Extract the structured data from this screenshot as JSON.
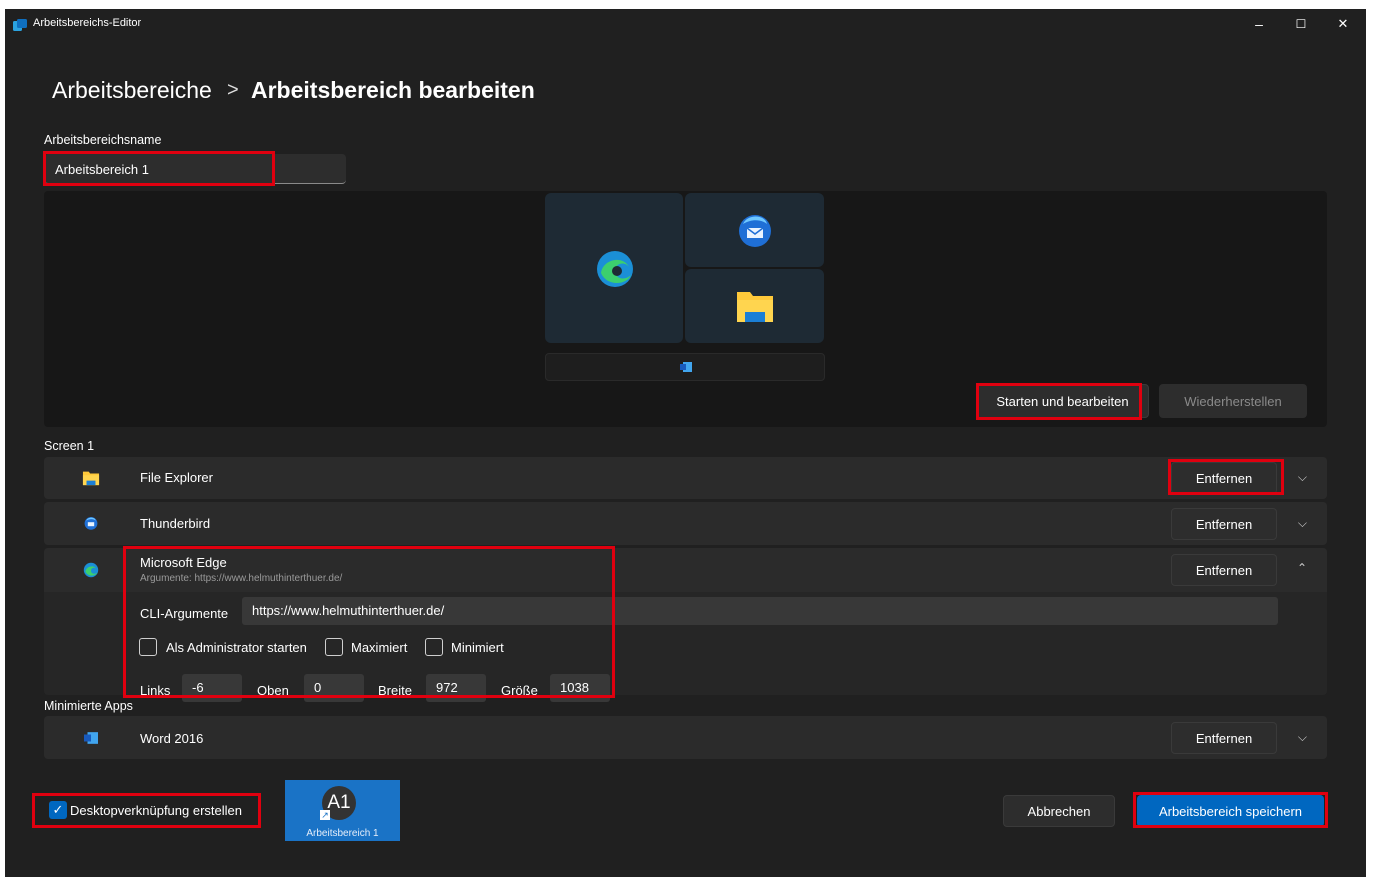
{
  "window": {
    "title": "Arbeitsbereichs-Editor",
    "minimize": "–",
    "maximize": "☐",
    "close": "✕"
  },
  "breadcrumb": {
    "parent": "Arbeitsbereiche",
    "separator": ">",
    "current": "Arbeitsbereich bearbeiten"
  },
  "name_field": {
    "label": "Arbeitsbereichsname",
    "value": "Arbeitsbereich 1"
  },
  "preview": {
    "launch_edit": "Starten und bearbeiten",
    "restore": "Wiederherstellen"
  },
  "screen1": {
    "label": "Screen 1",
    "apps": [
      {
        "name": "File Explorer",
        "remove": "Entfernen"
      },
      {
        "name": "Thunderbird",
        "remove": "Entfernen"
      },
      {
        "name": "Microsoft Edge",
        "args_summary": "Argumente: https://www.helmuthinterthuer.de/",
        "remove": "Entfernen"
      }
    ]
  },
  "edge_details": {
    "cli_label": "CLI-Argumente",
    "cli_value": "https://www.helmuthinterthuer.de/",
    "admin": "Als Administrator starten",
    "maximized": "Maximiert",
    "minimized": "Minimiert",
    "left_label": "Links",
    "left_value": "-6",
    "top_label": "Oben",
    "top_value": "0",
    "width_label": "Breite",
    "width_value": "972",
    "height_label": "Größe",
    "height_value": "1038"
  },
  "minimized_apps": {
    "label": "Minimierte Apps",
    "apps": [
      {
        "name": "Word 2016",
        "remove": "Entfernen"
      }
    ]
  },
  "footer": {
    "desktop_shortcut": "Desktopverknüpfung erstellen",
    "shortcut_initials": "A1",
    "shortcut_label": "Arbeitsbereich 1",
    "cancel": "Abbrechen",
    "save": "Arbeitsbereich speichern"
  },
  "colors": {
    "accent": "#0067c0",
    "highlight": "#e0000f",
    "background": "#202020"
  }
}
